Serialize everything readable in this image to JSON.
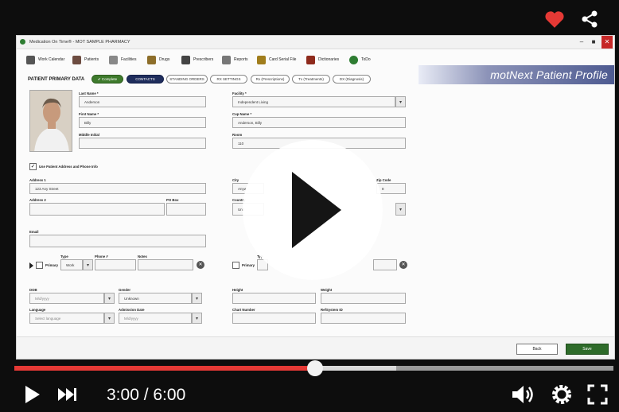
{
  "overlay": {
    "top_icons": [
      "heart-icon",
      "share-icon"
    ]
  },
  "app": {
    "window_title": "Medication On Time® - MOT SAMPLE PHARMACY",
    "window_buttons": {
      "minimize": "–",
      "maximize": "■",
      "close": "✕"
    },
    "menu": [
      {
        "label": "Work Calendar",
        "icon": "calendar-icon"
      },
      {
        "label": "Patients",
        "icon": "patients-icon"
      },
      {
        "label": "Facilities",
        "icon": "facility-icon"
      },
      {
        "label": "Drugs",
        "icon": "drug-icon"
      },
      {
        "label": "Prescribers",
        "icon": "prescriber-icon"
      },
      {
        "label": "Reports",
        "icon": "report-icon"
      },
      {
        "label": "Card Serial File",
        "icon": "card-icon"
      },
      {
        "label": "Dictionaries",
        "icon": "dictionary-icon"
      },
      {
        "label": "ToDo",
        "icon": "todo-icon"
      }
    ],
    "banner": "motNext Patient Profile",
    "section_title": "PATIENT PRIMARY DATA",
    "tabs": [
      {
        "label": "✔ Complete",
        "state": "complete"
      },
      {
        "label": "CONTACTS",
        "state": "active"
      },
      {
        "label": "STANDING ORDERS",
        "state": "normal"
      },
      {
        "label": "RX SETTINGS",
        "state": "normal"
      },
      {
        "label": "Rx (Prescriptions)",
        "state": "normal"
      },
      {
        "label": "Tx (Treatments)",
        "state": "normal"
      },
      {
        "label": "DX (Diagnosis)",
        "state": "normal"
      }
    ],
    "form": {
      "last_name": {
        "label": "Last Name *",
        "value": "Anderson"
      },
      "first_name": {
        "label": "First Name *",
        "value": "Billy"
      },
      "middle_initial": {
        "label": "Middle Initial",
        "value": ""
      },
      "facility": {
        "label": "Facility *",
        "value": "Independent Living"
      },
      "cup_name": {
        "label": "Cup Name *",
        "value": "Anderson, Billy"
      },
      "room": {
        "label": "Room",
        "value": "110"
      },
      "use_facility_address": {
        "label": "Use Patient Address and Phone Info",
        "checked": true
      },
      "address1": {
        "label": "Address 1",
        "value": "123 Any Street"
      },
      "address2": {
        "label": "Address 2",
        "value": ""
      },
      "po_box": {
        "label": "PO Box",
        "value": ""
      },
      "city": {
        "label": "City",
        "value": "Anyw"
      },
      "zip": {
        "label": "Zip Code",
        "value": "8"
      },
      "country": {
        "label": "Country",
        "value": "Unit"
      },
      "email": {
        "label": "Email",
        "value": ""
      },
      "phone_left": {
        "primary_label": "Primary",
        "type_label": "Type",
        "type_value": "Work",
        "phone_label": "Phone #",
        "notes_label": "Notes"
      },
      "phone_right": {
        "primary_label": "Primary",
        "type_label": "Typ"
      },
      "dob": {
        "label": "DOB",
        "placeholder": "M/d/yyyy"
      },
      "gender": {
        "label": "Gender",
        "value": "Unknown"
      },
      "language": {
        "label": "Language",
        "placeholder": "Select language"
      },
      "admission_date": {
        "label": "Admission Date",
        "placeholder": "M/d/yyyy"
      },
      "height": {
        "label": "Height",
        "value": ""
      },
      "weight": {
        "label": "Weight",
        "value": ""
      },
      "chart_number": {
        "label": "Chart Number",
        "value": ""
      },
      "ref_system_id": {
        "label": "RefSystem ID",
        "value": ""
      }
    },
    "buttons": {
      "back": "Back",
      "save": "Save"
    }
  },
  "player": {
    "time": "3:00 / 6:00",
    "progress_played": 0.5,
    "progress_buffered": 0.64,
    "icons": [
      "play-icon",
      "next-icon",
      "volume-icon",
      "settings-icon",
      "fullscreen-icon"
    ]
  }
}
